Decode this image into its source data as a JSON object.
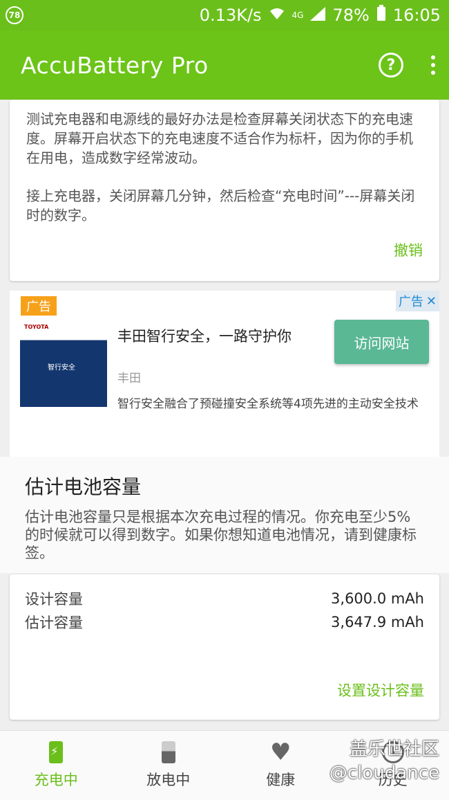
{
  "status_bar": {
    "badge": "78",
    "speed": "0.13K/s",
    "network": "4G",
    "battery": "78%",
    "time": "16:05"
  },
  "app_bar": {
    "title": "AccuBattery Pro",
    "help_icon": "help-circle-icon",
    "more_icon": "more-vert-icon"
  },
  "tip_card": {
    "paragraph1": "测试充电器和电源线的最好办法是检查屏幕关闭状态下的充电速度。屏幕开启状态下的充电速度不适合作为标杆，因为你的手机在用电，造成数字经常波动。",
    "paragraph2": "接上充电器，关闭屏幕几分钟，然后检查“充电时间”---屏幕关闭时的数字。",
    "undo": "撤销"
  },
  "ad": {
    "tag": "广告",
    "tag_right": "广告",
    "brand_logo": "TOYOTA",
    "image_text": "智行安全",
    "title": "丰田智行安全，一路守护你",
    "brand": "丰田",
    "description": "智行安全融合了预碰撞安全系统等4项先进的主动安全技术",
    "button": "访问网站"
  },
  "capacity_section": {
    "title": "估计电池容量",
    "description": "估计电池容量只是根据本次充电过程的情况。你充电至少5%的时候就可以得到数字。如果你想知道电池情况，请到健康标签。"
  },
  "capacity_card": {
    "rows": [
      {
        "label": "设计容量",
        "value": "3,600.0 mAh"
      },
      {
        "label": "估计容量",
        "value": "3,647.9 mAh"
      }
    ],
    "set_button": "设置设计容量"
  },
  "bottom_nav": {
    "items": [
      {
        "label": "充电中",
        "icon": "battery-charging-icon",
        "active": true
      },
      {
        "label": "放电中",
        "icon": "battery-icon",
        "active": false
      },
      {
        "label": "健康",
        "icon": "heart-icon",
        "active": false
      },
      {
        "label": "历史",
        "icon": "history-icon",
        "active": false
      }
    ]
  },
  "watermark": {
    "line1": "盖乐世社区",
    "line2": "@cloudance"
  },
  "colors": {
    "accent": "#6bbf1b",
    "ad_button": "#5ab894",
    "ad_tag": "#f7a11a"
  }
}
